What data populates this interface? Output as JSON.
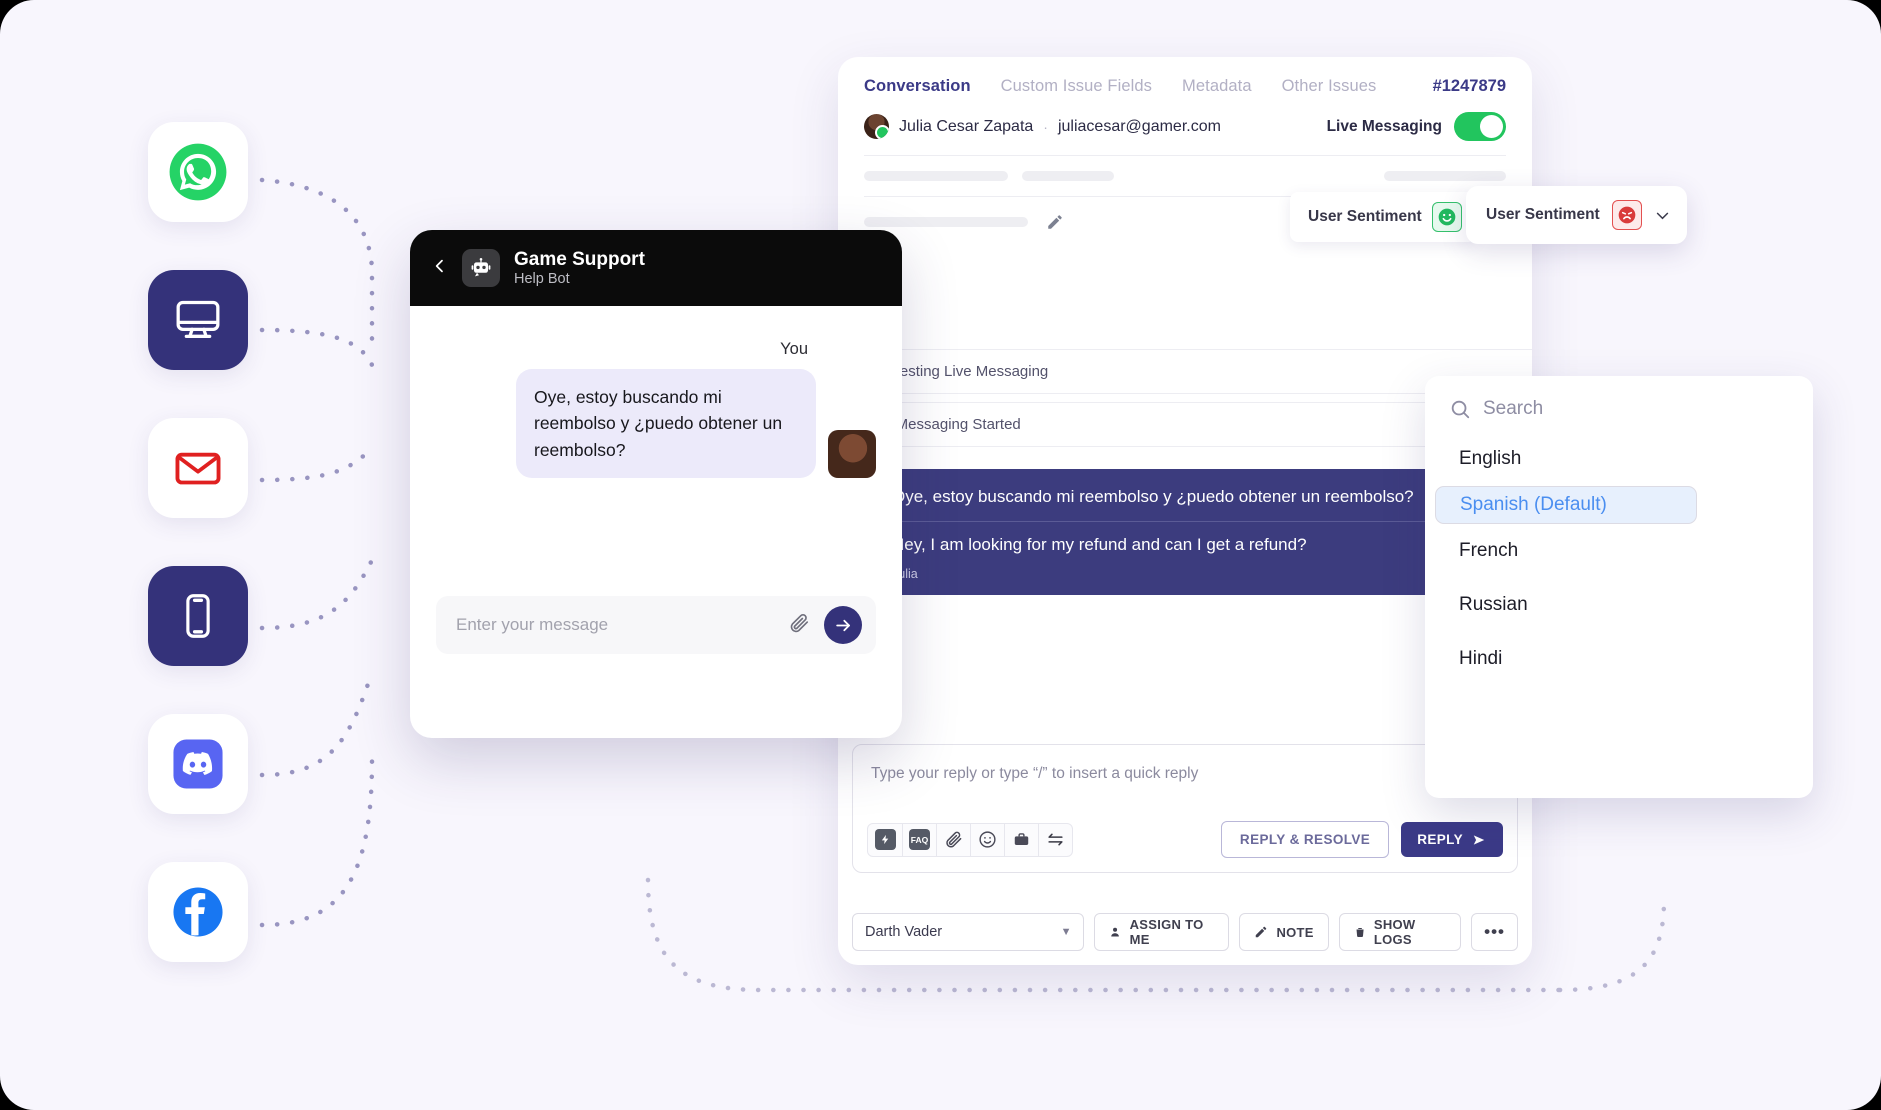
{
  "canvas": {
    "background": "#f8f6fd",
    "frame": "#000000"
  },
  "channels": [
    {
      "name": "whatsapp",
      "icon": "whatsapp-icon",
      "style": "light",
      "color": "#25d366"
    },
    {
      "name": "web",
      "icon": "desktop-monitor-icon",
      "style": "dark",
      "color": "#34327a"
    },
    {
      "name": "email",
      "icon": "envelope-icon",
      "style": "light",
      "color": "#e02020"
    },
    {
      "name": "mobile",
      "icon": "smartphone-icon",
      "style": "dark",
      "color": "#34327a"
    },
    {
      "name": "discord",
      "icon": "discord-icon",
      "style": "light",
      "color": "#5865f2"
    },
    {
      "name": "facebook",
      "icon": "facebook-icon",
      "style": "light",
      "color": "#1877f2"
    }
  ],
  "desk": {
    "tabs": [
      {
        "label": "Conversation",
        "active": true
      },
      {
        "label": "Custom Issue Fields",
        "active": false
      },
      {
        "label": "Metadata",
        "active": false
      },
      {
        "label": "Other Issues",
        "active": false
      }
    ],
    "ticket_id": "#1247879",
    "user": {
      "name": "Julia Cesar Zapata",
      "separator": "·",
      "email": "juliacesar@gamer.com",
      "presence": "online"
    },
    "live_messaging": {
      "label": "Live Messaging",
      "enabled": true
    },
    "logs": [
      "Requesting Live Messaging",
      "Live Messaging Started"
    ],
    "message": {
      "original": "Oye, estoy buscando mi reembolso y ¿puedo obtener un reembolso?",
      "translated": "Hey, I am looking for my refund and can I get a refund?",
      "author": "Julia",
      "translate_icon": "translate-icon",
      "bubble_color": "#3c3c7e"
    },
    "composer": {
      "placeholder": "Type your reply or type “/” to insert a quick reply",
      "translate_icon": "translate-icon",
      "collapse_icon": "chevron-up-icon",
      "tools": [
        {
          "name": "quick-reply",
          "icon": "lightning-bolt-icon",
          "label": ""
        },
        {
          "name": "faq",
          "icon": "faq-icon",
          "label": "FAQ"
        },
        {
          "name": "attach",
          "icon": "paperclip-icon",
          "label": ""
        },
        {
          "name": "emoji",
          "icon": "smiley-icon",
          "label": ""
        },
        {
          "name": "canned",
          "icon": "briefcase-icon",
          "label": ""
        },
        {
          "name": "transfer",
          "icon": "transfer-arrows-icon",
          "label": ""
        }
      ],
      "reply_resolve_label": "REPLY & RESOLVE",
      "reply_label": "REPLY"
    },
    "bottom_bar": {
      "assignee": "Darth Vader",
      "assign_to_me": "ASSIGN TO ME",
      "note": "NOTE",
      "show_logs": "SHOW LOGS",
      "more": "•••"
    }
  },
  "sentiment": {
    "back_label": "User Sentiment",
    "back_face": "smiling-face-icon",
    "front_label": "User Sentiment",
    "front_face": "frowning-face-icon",
    "chevron": "chevron-down-icon",
    "good_color": "#35c06c",
    "bad_color": "#e35050"
  },
  "language_dropdown": {
    "search_placeholder": "Search",
    "search_icon": "search-icon",
    "items": [
      {
        "label": "English",
        "selected": false
      },
      {
        "label": "Spanish (Default)",
        "selected": true
      },
      {
        "label": "French",
        "selected": false
      },
      {
        "label": "Russian",
        "selected": false
      },
      {
        "label": "Hindi",
        "selected": false
      }
    ],
    "selected_color": "#4a8ef0"
  },
  "widget": {
    "back_icon": "chevron-left-icon",
    "bot_icon": "robot-icon",
    "title": "Game Support",
    "subtitle": "Help Bot",
    "sender_label": "You",
    "message": "Oye, estoy buscando mi reembolso y ¿puedo obtener un reembolso?",
    "input_placeholder": "Enter your message",
    "attach_icon": "paperclip-icon",
    "send_icon": "arrow-right-icon",
    "send_color": "#34327a"
  }
}
